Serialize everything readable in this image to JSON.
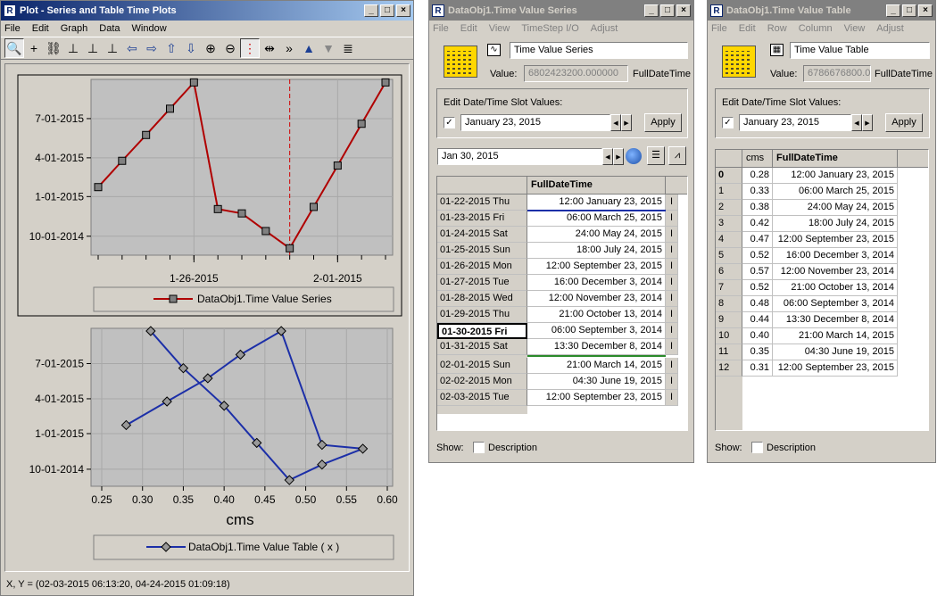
{
  "plot_window": {
    "title": "Plot - Series and Table Time Plots",
    "menu": [
      "File",
      "Edit",
      "Graph",
      "Data",
      "Window"
    ],
    "legend1": "DataObj1.Time Value Series",
    "legend2": "DataObj1.Time Value Table ( x )",
    "status": "X, Y = (02-03-2015 06:13:20, 04-24-2015 01:09:18)",
    "colors": {
      "series": "#b00000",
      "table": "#1c2fa8",
      "plot_bg": "#c0c0c0"
    }
  },
  "chart_data": [
    {
      "type": "line",
      "series": [
        {
          "name": "DataObj1.Time Value Series",
          "x": [
            "01-22-2015",
            "01-23-2015",
            "01-24-2015",
            "01-25-2015",
            "01-26-2015",
            "01-27-2015",
            "01-28-2015",
            "01-29-2015",
            "01-30-2015",
            "01-31-2015",
            "02-01-2015",
            "02-02-2015",
            "02-03-2015"
          ],
          "y": [
            "01-23-2015",
            "03-25-2015",
            "05-24-2015",
            "07-24-2015",
            "09-23-2015",
            "12-03-2014",
            "11-23-2014",
            "10-13-2014",
            "09-03-2014",
            "12-08-2014",
            "03-14-2015",
            "06-19-2015",
            "09-23-2015"
          ]
        }
      ],
      "xticks": [
        "1-26-2015",
        "2-01-2015"
      ],
      "yticks": [
        "10-01-2014",
        "1-01-2015",
        "4-01-2015",
        "7-01-2015"
      ],
      "cursor_x": "01-30-2015",
      "grid": true
    },
    {
      "type": "line",
      "series": [
        {
          "name": "DataObj1.Time Value Table ( x )",
          "x": [
            0.28,
            0.33,
            0.38,
            0.42,
            0.47,
            0.52,
            0.57,
            0.52,
            0.48,
            0.44,
            0.4,
            0.35,
            0.31
          ],
          "y": [
            "01-23-2015",
            "03-25-2015",
            "05-24-2015",
            "07-24-2015",
            "09-23-2015",
            "12-03-2014",
            "11-23-2014",
            "10-13-2014",
            "09-03-2014",
            "12-08-2014",
            "03-14-2015",
            "06-19-2015",
            "09-23-2015"
          ]
        }
      ],
      "xticks": [
        "0.25",
        "0.30",
        "0.35",
        "0.40",
        "0.45",
        "0.50",
        "0.55",
        "0.60"
      ],
      "xlabel": "cms",
      "xlim": [
        0.25,
        0.6
      ],
      "yticks": [
        "10-01-2014",
        "1-01-2015",
        "4-01-2015",
        "7-01-2015"
      ],
      "grid": true
    }
  ],
  "series_window": {
    "title": "DataObj1.Time Value Series",
    "menu": [
      "File",
      "Edit",
      "View",
      "TimeStep I/O",
      "Adjust"
    ],
    "name": "Time Value Series",
    "value_label": "Value:",
    "value": "6802423200.000000",
    "unit": "FullDateTime",
    "edit_label": "Edit Date/Time Slot Values:",
    "edit_date": "January 23, 2015",
    "apply": "Apply",
    "nav_date": "Jan 30, 2015",
    "col_header": "FullDateTime",
    "rows": [
      {
        "date": "01-22-2015 Thu",
        "value": "12:00 January 23, 2015",
        "flag": "I"
      },
      {
        "date": "01-23-2015 Fri",
        "value": "06:00 March 25, 2015",
        "flag": "I"
      },
      {
        "date": "01-24-2015 Sat",
        "value": "24:00 May 24, 2015",
        "flag": "I"
      },
      {
        "date": "01-25-2015 Sun",
        "value": "18:00 July 24, 2015",
        "flag": "I"
      },
      {
        "date": "01-26-2015 Mon",
        "value": "12:00 September 23, 2015",
        "flag": "I"
      },
      {
        "date": "01-27-2015 Tue",
        "value": "16:00 December 3, 2014",
        "flag": "I"
      },
      {
        "date": "01-28-2015 Wed",
        "value": "12:00 November 23, 2014",
        "flag": "I"
      },
      {
        "date": "01-29-2015 Thu",
        "value": "21:00 October 13, 2014",
        "flag": "I"
      },
      {
        "date": "01-30-2015 Fri",
        "value": "06:00 September 3, 2014",
        "flag": "I"
      },
      {
        "date": "01-31-2015 Sat",
        "value": "13:30 December 8, 2014",
        "flag": "I"
      },
      {
        "date": "02-01-2015 Sun",
        "value": "21:00 March 14, 2015",
        "flag": "I"
      },
      {
        "date": "02-02-2015 Mon",
        "value": "04:30 June 19, 2015",
        "flag": "I"
      },
      {
        "date": "02-03-2015 Tue",
        "value": "12:00 September 23, 2015",
        "flag": "I"
      }
    ],
    "show_label": "Show:",
    "desc_label": "Description"
  },
  "table_window": {
    "title": "DataObj1.Time Value Table",
    "menu": [
      "File",
      "Edit",
      "Row",
      "Column",
      "View",
      "Adjust"
    ],
    "name": "Time Value Table",
    "value_label": "Value:",
    "value": "6786676800.0",
    "unit": "FullDateTime",
    "edit_label": "Edit Date/Time Slot Values:",
    "edit_date": "January 23, 2015",
    "apply": "Apply",
    "col1": "cms",
    "col2": "FullDateTime",
    "rows": [
      {
        "i": "0",
        "cms": "0.28",
        "dt": "12:00 January 23, 2015"
      },
      {
        "i": "1",
        "cms": "0.33",
        "dt": "06:00 March 25, 2015"
      },
      {
        "i": "2",
        "cms": "0.38",
        "dt": "24:00 May 24, 2015"
      },
      {
        "i": "3",
        "cms": "0.42",
        "dt": "18:00 July 24, 2015"
      },
      {
        "i": "4",
        "cms": "0.47",
        "dt": "12:00 September 23, 2015"
      },
      {
        "i": "5",
        "cms": "0.52",
        "dt": "16:00 December 3, 2014"
      },
      {
        "i": "6",
        "cms": "0.57",
        "dt": "12:00 November 23, 2014"
      },
      {
        "i": "7",
        "cms": "0.52",
        "dt": "21:00 October 13, 2014"
      },
      {
        "i": "8",
        "cms": "0.48",
        "dt": "06:00 September 3, 2014"
      },
      {
        "i": "9",
        "cms": "0.44",
        "dt": "13:30 December 8, 2014"
      },
      {
        "i": "10",
        "cms": "0.40",
        "dt": "21:00 March 14, 2015"
      },
      {
        "i": "11",
        "cms": "0.35",
        "dt": "04:30 June 19, 2015"
      },
      {
        "i": "12",
        "cms": "0.31",
        "dt": "12:00 September 23, 2015"
      }
    ],
    "show_label": "Show:",
    "desc_label": "Description"
  }
}
